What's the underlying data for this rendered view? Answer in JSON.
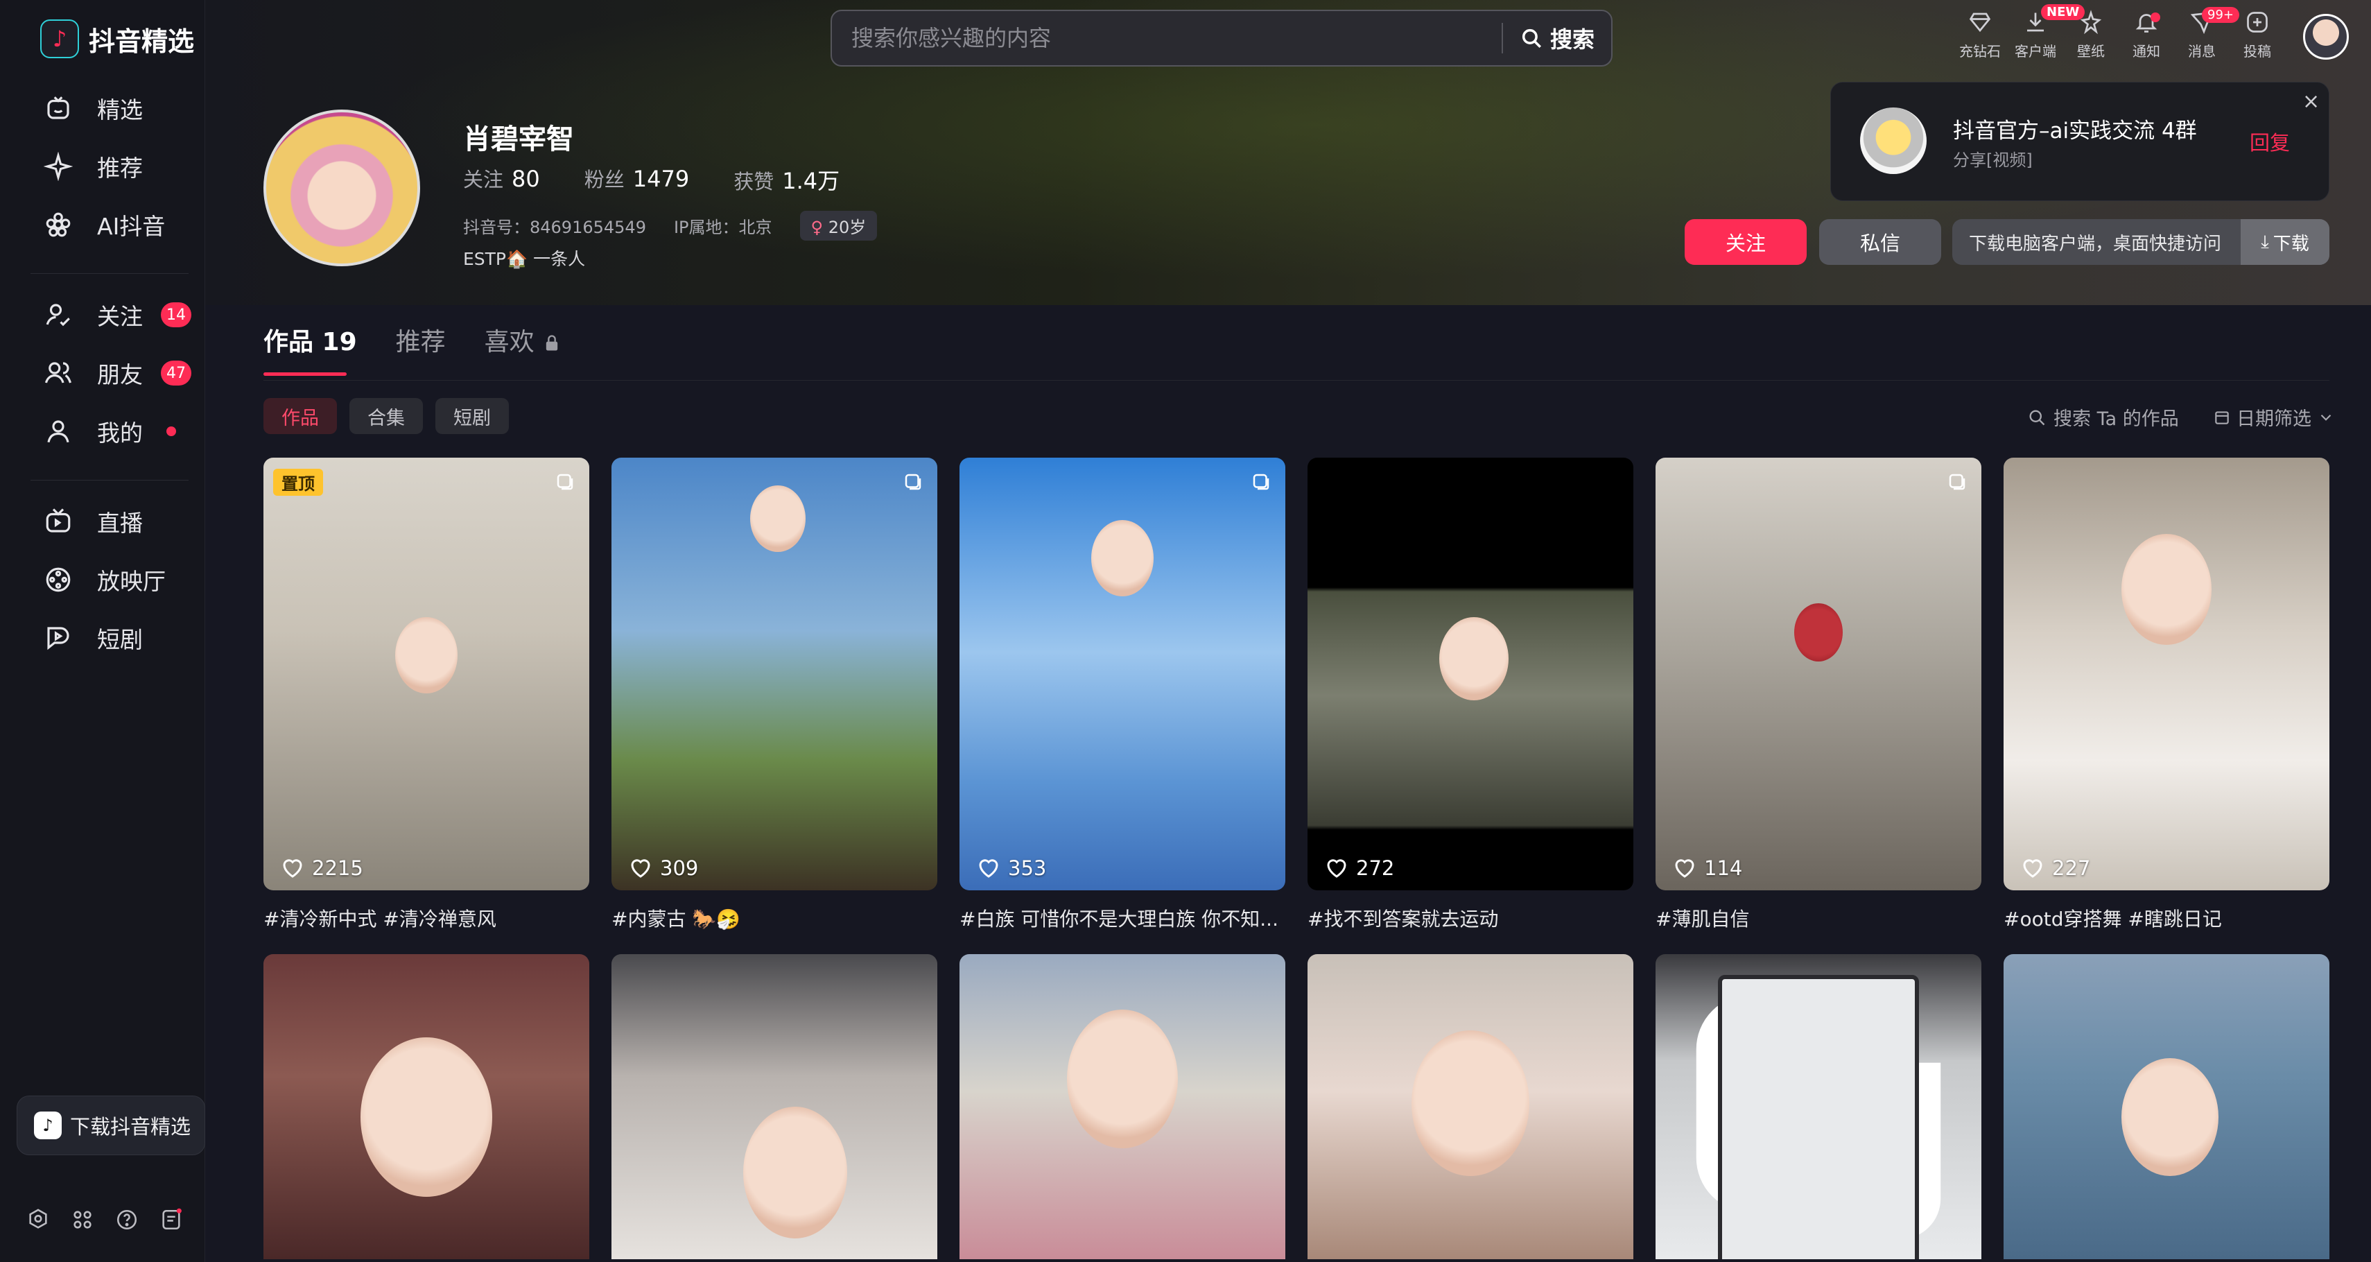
{
  "app": {
    "logo_text": "抖音精选"
  },
  "sidebar": {
    "items": [
      {
        "label": "精选",
        "icon": "smile-tv-icon"
      },
      {
        "label": "推荐",
        "icon": "sparkle-icon"
      },
      {
        "label": "AI抖音",
        "icon": "flower-icon"
      },
      {
        "label": "关注",
        "icon": "follow-icon",
        "badge": "14"
      },
      {
        "label": "朋友",
        "icon": "friends-icon",
        "badge": "47"
      },
      {
        "label": "我的",
        "icon": "user-icon",
        "dot": true
      },
      {
        "label": "直播",
        "icon": "tv-icon"
      },
      {
        "label": "放映厅",
        "icon": "film-reel-icon"
      },
      {
        "label": "短剧",
        "icon": "drama-icon"
      }
    ],
    "download_label": "下载抖音精选"
  },
  "search": {
    "placeholder": "搜索你感兴趣的内容",
    "button_label": "搜索"
  },
  "top_icons": [
    {
      "label": "充钻石",
      "icon": "diamond-icon"
    },
    {
      "label": "客户端",
      "icon": "download-icon",
      "tag": "NEW"
    },
    {
      "label": "壁纸",
      "icon": "wallpaper-icon"
    },
    {
      "label": "通知",
      "icon": "bell-icon",
      "dot": true
    },
    {
      "label": "消息",
      "icon": "message-icon",
      "tag": "99+"
    },
    {
      "label": "投稿",
      "icon": "upload-icon"
    }
  ],
  "profile": {
    "name": "肖碧宰智",
    "following_label": "关注",
    "following": "80",
    "followers_label": "粉丝",
    "followers": "1479",
    "likes_label": "获赞",
    "likes": "1.4万",
    "douyin_id": "抖音号：84691654549",
    "ip": "IP属地：北京",
    "age": "20岁",
    "bio": "ESTP🏠 一条人"
  },
  "actions": {
    "follow": "关注",
    "message": "私信",
    "download_text": "下载电脑客户端，桌面快捷访问",
    "download_btn": "下载"
  },
  "notification": {
    "title": "抖音官方–ai实践交流 4群",
    "subtitle": "分享[视频]",
    "reply": "回复",
    "close": "×"
  },
  "tabs": [
    {
      "label": "作品 19",
      "active": true
    },
    {
      "label": "推荐"
    },
    {
      "label": "喜欢",
      "locked": true
    }
  ],
  "chips": [
    {
      "label": "作品",
      "active": true
    },
    {
      "label": "合集"
    },
    {
      "label": "短剧"
    }
  ],
  "works_search": "搜索 Ta 的作品",
  "date_filter": "日期筛选",
  "works": [
    {
      "likes": "2215",
      "caption": "#清冷新中式 #清冷禅意风",
      "pinned": "置顶",
      "multi": true,
      "bg": "linear-gradient(180deg,#d9d4cb 0%,#c9c2b6 40%,#8a8479 100%)"
    },
    {
      "likes": "309",
      "caption": "#内蒙古 🐎🤧",
      "multi": true,
      "bg": "linear-gradient(180deg,#4c86c8 0%,#8ab3d8 40%,#6a8a4a 70%,#3c3224 100%)"
    },
    {
      "likes": "353",
      "caption": "#白族 可惜你不是大理白族 你不知...",
      "multi": true,
      "bg": "linear-gradient(180deg,#2f7fd6 0%,#9cc6ee 45%,#5b94d4 75%,#3b6db8 100%)"
    },
    {
      "likes": "272",
      "caption": "#找不到答案就去运动",
      "multi": false,
      "bg": "linear-gradient(180deg,#000 0%,#000 30%,#4a4f3e 31%,#7c7f70 55%,#3b3d33 85%,#000 86%)"
    },
    {
      "likes": "114",
      "caption": "#薄肌自信",
      "multi": true,
      "bg": "linear-gradient(180deg,#d5d0c8 0%,#a9a49b 45%,#6b655d 100%)"
    },
    {
      "likes": "227",
      "caption": "#ootd穿搭舞 #瞎跳日记",
      "multi": false,
      "bg": "linear-gradient(180deg,#a49a8d 0%,#d7cfc5 40%,#f1ede9 70%,#c9c2b8 100%)"
    },
    {
      "bg": "linear-gradient(180deg,#6a3a3a 0%,#8c5a52 40%,#4a2828 100%)"
    },
    {
      "bg": "linear-gradient(180deg,#4a4a4e 0%,#b8b2ae 40%,#e6e2de 100%)"
    },
    {
      "bg": "linear-gradient(180deg,#9aaac0 0%,#d8d4cc 45%,#c98c98 100%)"
    },
    {
      "bg": "linear-gradient(180deg,#c8c0b8 0%,#e8d8d0 45%,#a88878 100%)"
    },
    {
      "multi": true,
      "bg": "linear-gradient(180deg,#3a3a3e 0%,#c6c8ca 35%,#e8eaec 100%)"
    },
    {
      "bg": "linear-gradient(180deg,#8aa0b8 0%,#6a8ca8 40%,#4a6a88 100%)"
    }
  ]
}
